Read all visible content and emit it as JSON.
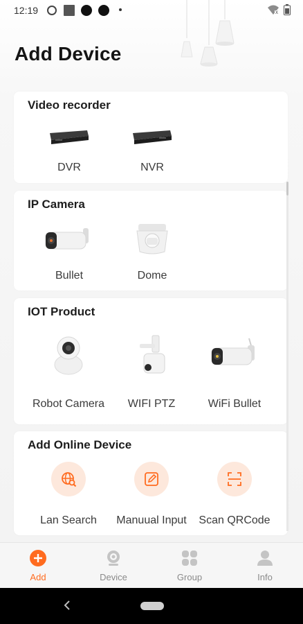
{
  "status_bar": {
    "time": "12:19"
  },
  "page": {
    "title": "Add Device"
  },
  "sections": {
    "video_recorder": {
      "title": "Video recorder",
      "items": [
        {
          "label": "DVR",
          "icon": "dvr-icon"
        },
        {
          "label": "NVR",
          "icon": "nvr-icon"
        }
      ]
    },
    "ip_camera": {
      "title": "IP Camera",
      "items": [
        {
          "label": "Bullet",
          "icon": "bullet-camera-icon"
        },
        {
          "label": "Dome",
          "icon": "dome-camera-icon"
        }
      ]
    },
    "iot_product": {
      "title": "IOT Product",
      "items": [
        {
          "label": "Robot Camera",
          "icon": "robot-camera-icon"
        },
        {
          "label": "WIFI PTZ",
          "icon": "wifi-ptz-icon"
        },
        {
          "label": "WiFi Bullet",
          "icon": "wifi-bullet-icon"
        }
      ]
    },
    "online_device": {
      "title": "Add Online Device",
      "items": [
        {
          "label": "Lan Search",
          "icon": "globe-search-icon"
        },
        {
          "label": "Manuual Input",
          "icon": "edit-icon"
        },
        {
          "label": "Scan QRCode",
          "icon": "scan-icon"
        }
      ]
    }
  },
  "bottom_nav": {
    "items": [
      {
        "label": "Add",
        "icon": "add-icon",
        "active": true
      },
      {
        "label": "Device",
        "icon": "device-icon",
        "active": false
      },
      {
        "label": "Group",
        "icon": "group-icon",
        "active": false
      },
      {
        "label": "Info",
        "icon": "person-icon",
        "active": false
      }
    ]
  },
  "colors": {
    "accent": "#ff6b1f",
    "accent_light": "#fde8dc",
    "card": "#ffffff",
    "background": "#f2f2f2"
  }
}
